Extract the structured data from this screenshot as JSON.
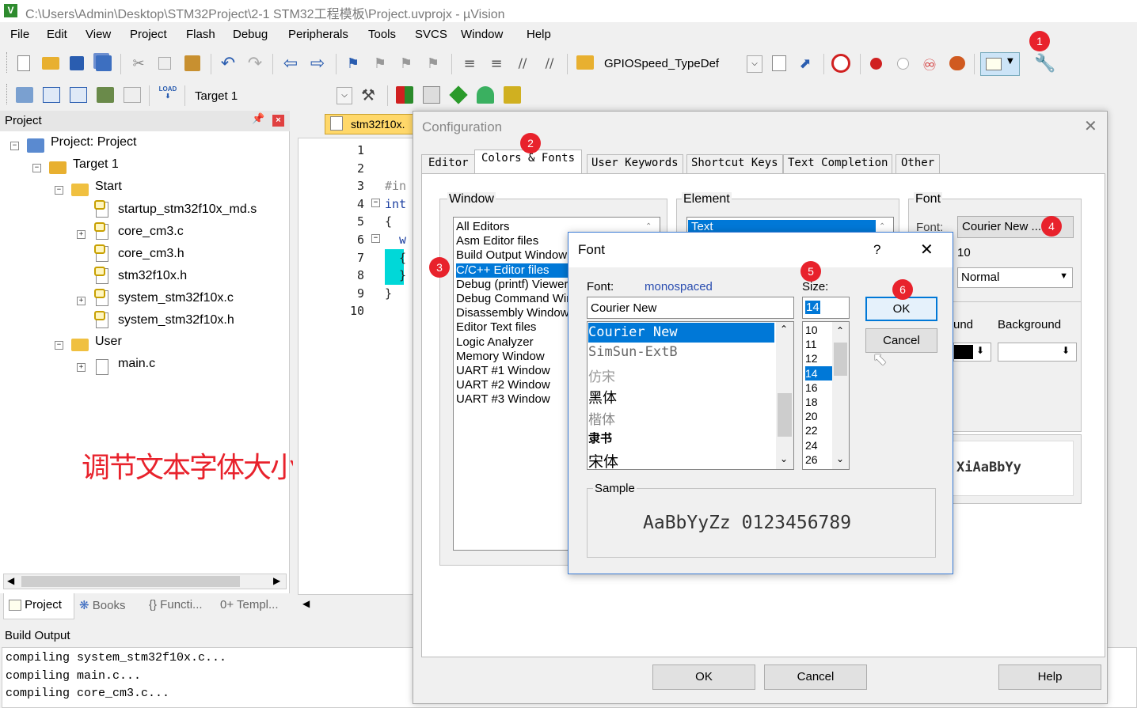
{
  "title_bar": {
    "path": "C:\\Users\\Admin\\Desktop\\STM32Project\\2-1 STM32工程模板\\Project.uvprojx - µVision"
  },
  "menu": [
    "File",
    "Edit",
    "View",
    "Project",
    "Flash",
    "Debug",
    "Peripherals",
    "Tools",
    "SVCS",
    "Window",
    "Help"
  ],
  "toolbar": {
    "find_combo": "GPIOSpeed_TypeDef",
    "target_combo": "Target 1"
  },
  "project_panel": {
    "title": "Project",
    "tree": [
      {
        "label": "Project: Project"
      },
      {
        "label": "Target 1"
      },
      {
        "label": "Start"
      },
      {
        "label": "startup_stm32f10x_md.s"
      },
      {
        "label": "core_cm3.c"
      },
      {
        "label": "core_cm3.h"
      },
      {
        "label": "stm32f10x.h"
      },
      {
        "label": "system_stm32f10x.c"
      },
      {
        "label": "system_stm32f10x.h"
      },
      {
        "label": "User"
      },
      {
        "label": "main.c"
      }
    ],
    "annotation": "调节文本字体大小",
    "tabs": [
      "Project",
      "Books",
      "{} Functi...",
      "0+ Templ..."
    ]
  },
  "editor": {
    "tab": "stm32f10x.",
    "line_numbers": [
      "1",
      "2",
      "3",
      "4",
      "5",
      "6",
      "7",
      "8",
      "9",
      "10"
    ],
    "code": [
      "#in",
      "",
      "int",
      "{",
      "  w",
      "  {",
      "",
      "  }",
      "}",
      ""
    ]
  },
  "build_output": {
    "title": "Build Output",
    "lines": [
      "compiling system_stm32f10x.c...",
      "compiling main.c...",
      "compiling core_cm3.c..."
    ]
  },
  "config_dialog": {
    "title": "Configuration",
    "tabs": [
      "Editor",
      "Colors & Fonts",
      "User Keywords",
      "Shortcut Keys",
      "Text Completion",
      "Other"
    ],
    "window_group": "Window",
    "window_items": [
      "All Editors",
      "Asm Editor files",
      "Build Output Window",
      "C/C++ Editor files",
      "Debug (printf) Viewer",
      "Debug Command Wir",
      "Disassembly Window",
      "Editor Text files",
      "Logic Analyzer",
      "Memory Window",
      "UART #1 Window",
      "UART #2 Window",
      "UART #3 Window"
    ],
    "element_group": "Element",
    "element_selected": "Text",
    "font_group": "Font",
    "font_label": "Font:",
    "font_button": "Courier New ...",
    "font_size": "10",
    "font_style": "Normal",
    "fg_label": "und",
    "bg_label": "Background",
    "sample": "XiAaBbYy",
    "buttons": {
      "ok": "OK",
      "cancel": "Cancel",
      "help": "Help"
    }
  },
  "font_dialog": {
    "title": "Font",
    "help": "?",
    "font_label": "Font:",
    "font_type": "monospaced",
    "font_value": "Courier New",
    "fonts": [
      "Courier New",
      "SimSun-ExtB",
      "仿宋",
      "黑体",
      "楷体",
      "隶书",
      "宋体"
    ],
    "size_label": "Size:",
    "size_value": "14",
    "sizes": [
      "10",
      "11",
      "12",
      "14",
      "16",
      "18",
      "20",
      "22",
      "24",
      "26"
    ],
    "ok": "OK",
    "cancel": "Cancel",
    "sample_label": "Sample",
    "sample_text": "AaBbYyZz 0123456789"
  },
  "badges": [
    "1",
    "2",
    "3",
    "4",
    "5",
    "6"
  ],
  "colors": {
    "accent_red": "#e8222c",
    "selection_blue": "#0078d7",
    "annotation_red": "#e8222c"
  }
}
